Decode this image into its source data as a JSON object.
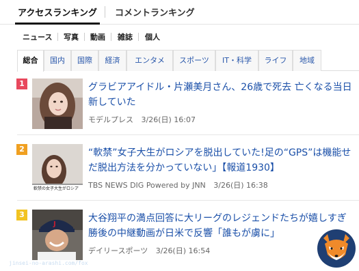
{
  "top_tabs": {
    "active": "アクセスランキング",
    "inactive": "コメントランキング"
  },
  "categories": [
    "ニュース",
    "写真",
    "動画",
    "雑誌",
    "個人"
  ],
  "sub_tabs": [
    "総合",
    "国内",
    "国際",
    "経済",
    "エンタメ",
    "スポーツ",
    "IT・科学",
    "ライフ",
    "地域"
  ],
  "articles": [
    {
      "rank": "1",
      "rank_color": "#e8485d",
      "title_line1": "グラビアアイドル・片瀬美月さん、26歳で死去 亡くなる当日",
      "title_line2": "新していた",
      "source": "モデルプレス",
      "time": "3/26(日) 16:07"
    },
    {
      "rank": "2",
      "rank_color": "#f0a021",
      "title_line1": "“軟禁”女子大生がロシアを脱出していた!足の“GPS”は機能せ",
      "title_line2": "だ脱出方法を分かっていない」【報道1930】",
      "source": "TBS NEWS DIG Powered by JNN",
      "time": "3/26(日) 16:38",
      "thumb_caption": "軟禁の女子大生がロシア"
    },
    {
      "rank": "3",
      "rank_color": "#f2c321",
      "title_line1": "大谷翔平の満点回答に大リーグのレジェンドたちが嬉しすぎ",
      "title_line2": "勝後の中継動画が日米で反響「誰もが虜に」",
      "source": "デイリースポーツ",
      "time": "3/26(日) 16:54"
    }
  ],
  "watermark": "jinsei-no-arashi.com/fox"
}
